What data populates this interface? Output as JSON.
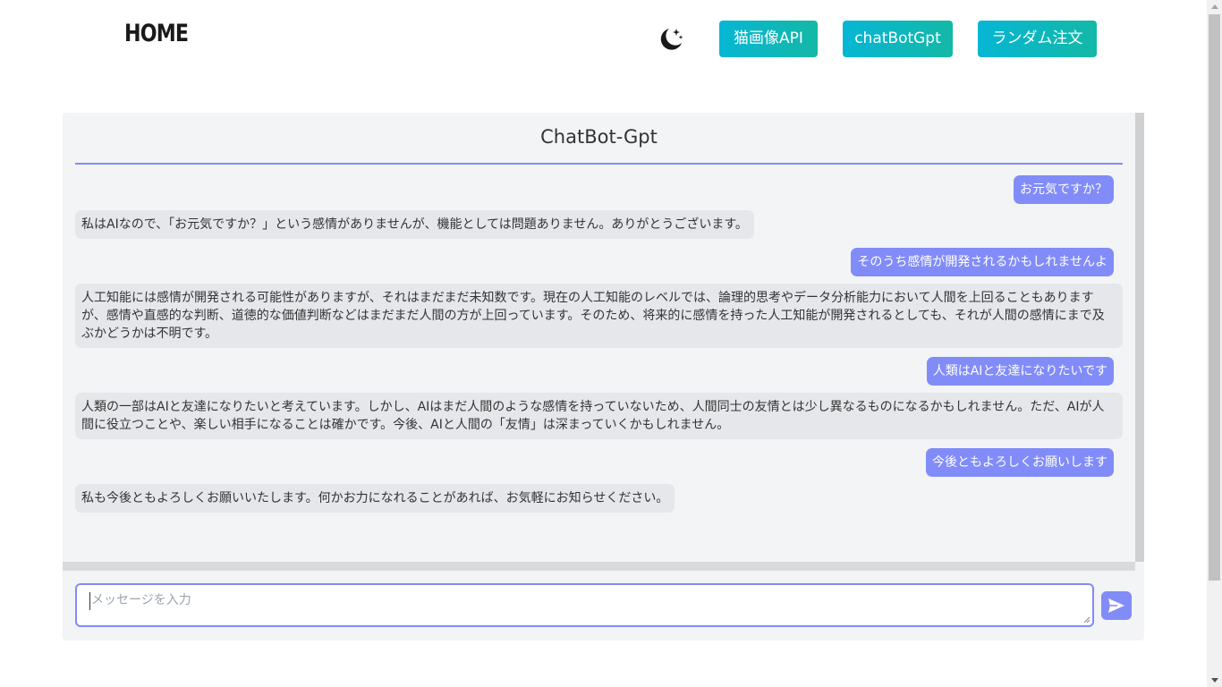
{
  "header": {
    "home_label": "HOME",
    "theme_icon": "moon-stars-icon",
    "nav": [
      {
        "label": "猫画像API"
      },
      {
        "label": "chatBotGpt"
      },
      {
        "label": "ランダム注文"
      }
    ]
  },
  "chat": {
    "title": "ChatBot-Gpt",
    "messages": [
      {
        "role": "user",
        "text": "お元気ですか？"
      },
      {
        "role": "bot",
        "text": "私はAIなので、「お元気ですか？」という感情がありませんが、機能としては問題ありません。ありがとうございます。"
      },
      {
        "role": "user",
        "text": "そのうち感情が開発されるかもしれませんよ"
      },
      {
        "role": "bot",
        "text": "人工知能には感情が開発される可能性がありますが、それはまだまだ未知数です。現在の人工知能のレベルでは、論理的思考やデータ分析能力において人間を上回ることもありますが、感情や直感的な判断、道徳的な価値判断などはまだまだ人間の方が上回っています。そのため、将来的に感情を持った人工知能が開発されるとしても、それが人間の感情にまで及ぶかどうかは不明です。"
      },
      {
        "role": "user",
        "text": "人類はAIと友達になりたいです"
      },
      {
        "role": "bot",
        "text": "人類の一部はAIと友達になりたいと考えています。しかし、AIはまだ人間のような感情を持っていないため、人間同士の友情とは少し異なるものになるかもしれません。ただ、AIが人間に役立つことや、楽しい相手になることは確かです。今後、AIと人間の「友情」は深まっていくかもしれません。"
      },
      {
        "role": "user",
        "text": "今後ともよろしくお願いします"
      },
      {
        "role": "bot",
        "text": "私も今後ともよろしくお願いいたします。何かお力になれることがあれば、お気軽にお知らせください。"
      }
    ],
    "input_placeholder": "メッセージを入力",
    "send_icon": "send-icon"
  },
  "colors": {
    "accent": "#818cf8",
    "nav_gradient_start": "#06b6d4",
    "nav_gradient_end": "#14b8a6",
    "bot_bubble": "#e5e7eb",
    "panel_bg": "#f3f4f6"
  }
}
